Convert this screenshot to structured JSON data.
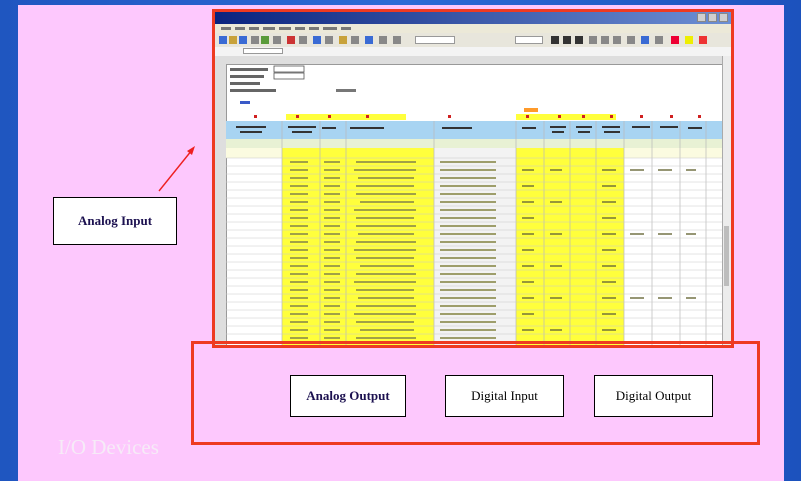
{
  "colors": {
    "slide": "#fdc8fd",
    "frame": "#ee3a21",
    "highlight": "#ffff3c",
    "header_band": "#a8d4f2",
    "background": "#2460c8"
  },
  "labels": {
    "analog_input": "Analog Input",
    "analog_output": "Analog Output",
    "digital_input": "Digital Input",
    "digital_output": "Digital Output"
  },
  "caption": "I/O Devices",
  "icons": [
    "close-icon",
    "maximize-icon",
    "minimize-icon",
    "arrow-icon"
  ]
}
